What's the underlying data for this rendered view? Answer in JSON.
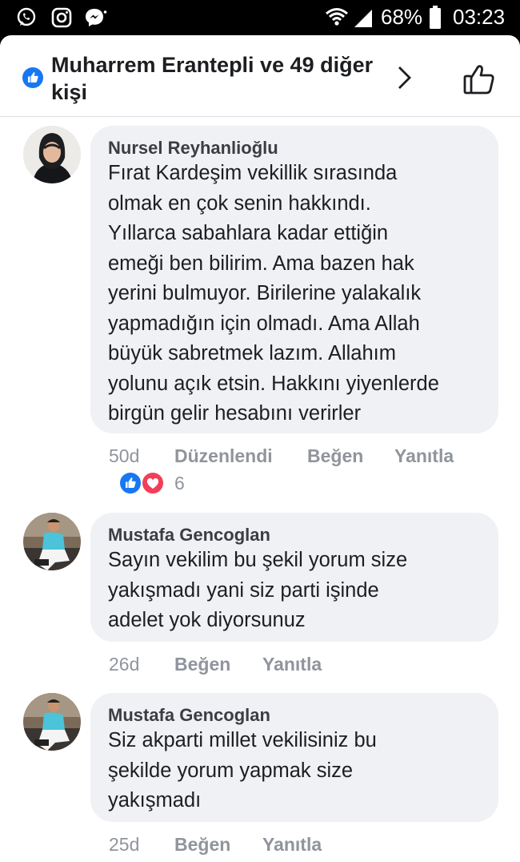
{
  "status_bar": {
    "battery": "68%",
    "time": "03:23"
  },
  "header": {
    "likers": "Muharrem Erantepli ve 49 diğer",
    "likers_line2": "kişi"
  },
  "comments": [
    {
      "author": "Nursel Reyhanlioğlu",
      "lines": [
        "Fırat Kardeşim vekillik sırasında",
        "olmak en çok senin hakkındı.",
        "Yıllarca sabahlara kadar ettiğin",
        "emeği ben bilirim. Ama bazen hak",
        "yerini bulmuyor. Birilerine yalakalık",
        "yapmadığın için olmadı. Ama Allah",
        "büyük sabretmek lazım. Allahım",
        "yolunu açık etsin. Hakkını yiyenlerde",
        "birgün gelir hesabını verirler"
      ],
      "time": "50d",
      "edited": "Düzenlendi",
      "like": "Beğen",
      "reply": "Yanıtla",
      "reaction_count": "6"
    },
    {
      "author": "Mustafa Gencoglan",
      "lines": [
        "Sayın vekilim bu şekil yorum size",
        "yakışmadı yani siz parti işinde",
        "adelet yok diyorsunuz"
      ],
      "time": "26d",
      "like": "Beğen",
      "reply": "Yanıtla"
    },
    {
      "author": "Mustafa Gencoglan",
      "lines": [
        "Siz akparti millet vekilisiniz bu",
        "şekilde yorum yapmak size",
        "yakışmadı"
      ],
      "time": "25d",
      "like": "Beğen",
      "reply": "Yanıtla"
    }
  ]
}
